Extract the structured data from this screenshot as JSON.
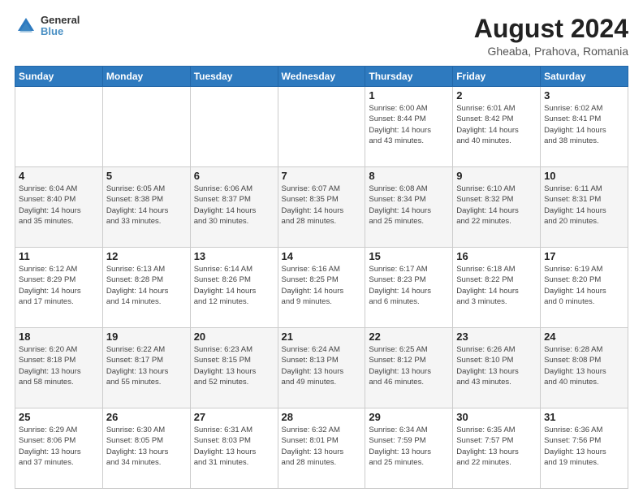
{
  "header": {
    "logo": {
      "line1": "General",
      "line2": "Blue"
    },
    "title": "August 2024",
    "subtitle": "Gheaba, Prahova, Romania"
  },
  "weekdays": [
    "Sunday",
    "Monday",
    "Tuesday",
    "Wednesday",
    "Thursday",
    "Friday",
    "Saturday"
  ],
  "weeks": [
    [
      {
        "day": "",
        "info": ""
      },
      {
        "day": "",
        "info": ""
      },
      {
        "day": "",
        "info": ""
      },
      {
        "day": "",
        "info": ""
      },
      {
        "day": "1",
        "info": "Sunrise: 6:00 AM\nSunset: 8:44 PM\nDaylight: 14 hours\nand 43 minutes."
      },
      {
        "day": "2",
        "info": "Sunrise: 6:01 AM\nSunset: 8:42 PM\nDaylight: 14 hours\nand 40 minutes."
      },
      {
        "day": "3",
        "info": "Sunrise: 6:02 AM\nSunset: 8:41 PM\nDaylight: 14 hours\nand 38 minutes."
      }
    ],
    [
      {
        "day": "4",
        "info": "Sunrise: 6:04 AM\nSunset: 8:40 PM\nDaylight: 14 hours\nand 35 minutes."
      },
      {
        "day": "5",
        "info": "Sunrise: 6:05 AM\nSunset: 8:38 PM\nDaylight: 14 hours\nand 33 minutes."
      },
      {
        "day": "6",
        "info": "Sunrise: 6:06 AM\nSunset: 8:37 PM\nDaylight: 14 hours\nand 30 minutes."
      },
      {
        "day": "7",
        "info": "Sunrise: 6:07 AM\nSunset: 8:35 PM\nDaylight: 14 hours\nand 28 minutes."
      },
      {
        "day": "8",
        "info": "Sunrise: 6:08 AM\nSunset: 8:34 PM\nDaylight: 14 hours\nand 25 minutes."
      },
      {
        "day": "9",
        "info": "Sunrise: 6:10 AM\nSunset: 8:32 PM\nDaylight: 14 hours\nand 22 minutes."
      },
      {
        "day": "10",
        "info": "Sunrise: 6:11 AM\nSunset: 8:31 PM\nDaylight: 14 hours\nand 20 minutes."
      }
    ],
    [
      {
        "day": "11",
        "info": "Sunrise: 6:12 AM\nSunset: 8:29 PM\nDaylight: 14 hours\nand 17 minutes."
      },
      {
        "day": "12",
        "info": "Sunrise: 6:13 AM\nSunset: 8:28 PM\nDaylight: 14 hours\nand 14 minutes."
      },
      {
        "day": "13",
        "info": "Sunrise: 6:14 AM\nSunset: 8:26 PM\nDaylight: 14 hours\nand 12 minutes."
      },
      {
        "day": "14",
        "info": "Sunrise: 6:16 AM\nSunset: 8:25 PM\nDaylight: 14 hours\nand 9 minutes."
      },
      {
        "day": "15",
        "info": "Sunrise: 6:17 AM\nSunset: 8:23 PM\nDaylight: 14 hours\nand 6 minutes."
      },
      {
        "day": "16",
        "info": "Sunrise: 6:18 AM\nSunset: 8:22 PM\nDaylight: 14 hours\nand 3 minutes."
      },
      {
        "day": "17",
        "info": "Sunrise: 6:19 AM\nSunset: 8:20 PM\nDaylight: 14 hours\nand 0 minutes."
      }
    ],
    [
      {
        "day": "18",
        "info": "Sunrise: 6:20 AM\nSunset: 8:18 PM\nDaylight: 13 hours\nand 58 minutes."
      },
      {
        "day": "19",
        "info": "Sunrise: 6:22 AM\nSunset: 8:17 PM\nDaylight: 13 hours\nand 55 minutes."
      },
      {
        "day": "20",
        "info": "Sunrise: 6:23 AM\nSunset: 8:15 PM\nDaylight: 13 hours\nand 52 minutes."
      },
      {
        "day": "21",
        "info": "Sunrise: 6:24 AM\nSunset: 8:13 PM\nDaylight: 13 hours\nand 49 minutes."
      },
      {
        "day": "22",
        "info": "Sunrise: 6:25 AM\nSunset: 8:12 PM\nDaylight: 13 hours\nand 46 minutes."
      },
      {
        "day": "23",
        "info": "Sunrise: 6:26 AM\nSunset: 8:10 PM\nDaylight: 13 hours\nand 43 minutes."
      },
      {
        "day": "24",
        "info": "Sunrise: 6:28 AM\nSunset: 8:08 PM\nDaylight: 13 hours\nand 40 minutes."
      }
    ],
    [
      {
        "day": "25",
        "info": "Sunrise: 6:29 AM\nSunset: 8:06 PM\nDaylight: 13 hours\nand 37 minutes."
      },
      {
        "day": "26",
        "info": "Sunrise: 6:30 AM\nSunset: 8:05 PM\nDaylight: 13 hours\nand 34 minutes."
      },
      {
        "day": "27",
        "info": "Sunrise: 6:31 AM\nSunset: 8:03 PM\nDaylight: 13 hours\nand 31 minutes."
      },
      {
        "day": "28",
        "info": "Sunrise: 6:32 AM\nSunset: 8:01 PM\nDaylight: 13 hours\nand 28 minutes."
      },
      {
        "day": "29",
        "info": "Sunrise: 6:34 AM\nSunset: 7:59 PM\nDaylight: 13 hours\nand 25 minutes."
      },
      {
        "day": "30",
        "info": "Sunrise: 6:35 AM\nSunset: 7:57 PM\nDaylight: 13 hours\nand 22 minutes."
      },
      {
        "day": "31",
        "info": "Sunrise: 6:36 AM\nSunset: 7:56 PM\nDaylight: 13 hours\nand 19 minutes."
      }
    ]
  ]
}
